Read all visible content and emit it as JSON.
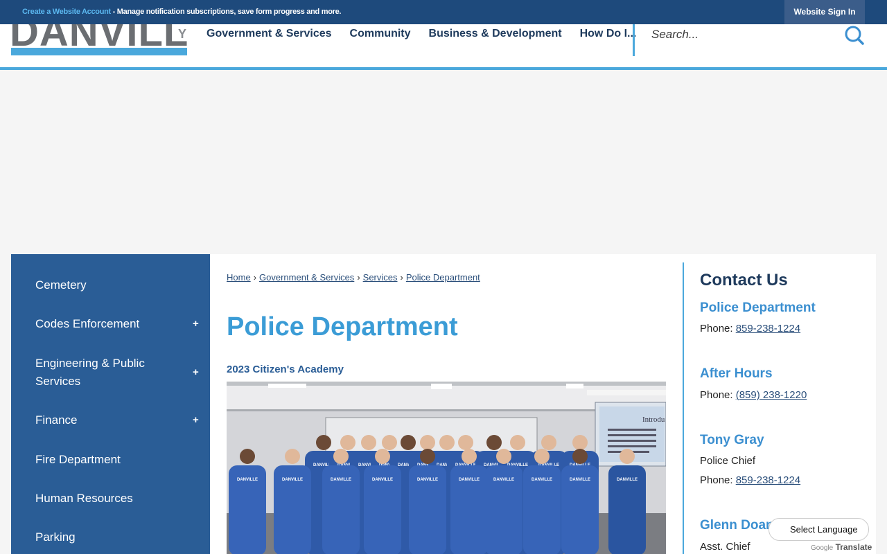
{
  "topbar": {
    "create_link": "Create a Website Account",
    "message": " - Manage notification subscriptions, save form progress and more.",
    "signin": "Website Sign In"
  },
  "header": {
    "logo_text": "DANVILLE",
    "logo_suffix": "Y",
    "nav": [
      "Government & Services",
      "Community",
      "Business & Development",
      "How Do I..."
    ],
    "search_placeholder": "Search..."
  },
  "sidebar": {
    "items": [
      {
        "label": "Cemetery",
        "expandable": false
      },
      {
        "label": "Codes Enforcement",
        "expandable": true
      },
      {
        "label": "Engineering & Public Services",
        "expandable": true
      },
      {
        "label": "Finance",
        "expandable": true
      },
      {
        "label": "Fire Department",
        "expandable": false
      },
      {
        "label": "Human Resources",
        "expandable": false
      },
      {
        "label": "Parking",
        "expandable": false
      }
    ],
    "plus": "+"
  },
  "breadcrumb": [
    "Home",
    "Government & Services",
    "Services",
    "Police Department"
  ],
  "breadcrumb_sep": "›",
  "page_title": "Police Department",
  "article_title": "2023 Citizen's Academy",
  "photo": {
    "slide_title": "Introdu",
    "shirt_text": "DANVILLE"
  },
  "contact": {
    "heading": "Contact Us",
    "entries": [
      {
        "name": "Police Department",
        "phone_label": "Phone: ",
        "phone": "859-238-1224"
      },
      {
        "name": "After Hours",
        "phone_label": "Phone: ",
        "phone": "(859) 238-1220"
      },
      {
        "name": "Tony Gray",
        "role": "Police Chief",
        "phone_label": "Phone: ",
        "phone": "859-238-1224"
      },
      {
        "name": "Glenn Doan",
        "role": "Asst. Chief"
      }
    ]
  },
  "translate": {
    "label": "Select Language",
    "powered_by": "Google",
    "translate": "Translate"
  },
  "colors": {
    "topbar": "#1e4a7c",
    "accent": "#4aa8dc",
    "sidebar": "#2a5d96",
    "title": "#3b9cd6"
  }
}
